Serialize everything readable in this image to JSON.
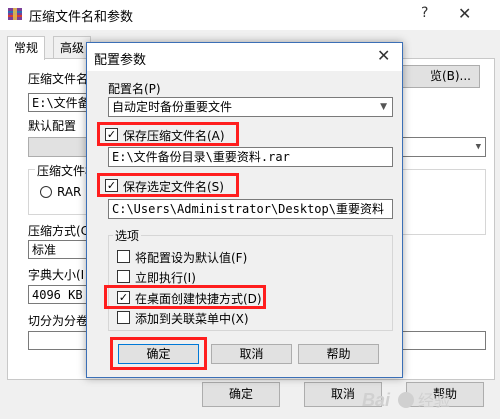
{
  "main": {
    "title": "压缩文件名和参数",
    "help": "?",
    "close": "✕",
    "tabs": [
      "常规",
      "高级"
    ],
    "archive_name_label": "压缩文件名",
    "archive_name_value": "E:\\文件备份",
    "browse_label": "览(B)...",
    "default_profile_label": "默认配置",
    "archive_format_label": "压缩文件格",
    "format_rar": "RAR",
    "method_label": "压缩方式(C",
    "method_value": "标准",
    "dict_label": "字典大小(I",
    "dict_value": "4096 KB",
    "split_label": "切分为分卷",
    "ok": "确定",
    "cancel": "取消",
    "help_btn": "帮助"
  },
  "dialog": {
    "title": "配置参数",
    "close": "✕",
    "profile_name_label": "配置名(P)",
    "profile_name_value": "自动定时备份重要文件",
    "save_archive_name_label": "保存压缩文件名(A)",
    "save_archive_name_checked": true,
    "archive_path": "E:\\文件备份目录\\重要资料.rar",
    "save_selected_names_label": "保存选定文件名(S)",
    "save_selected_names_checked": true,
    "selected_path": "C:\\Users\\Administrator\\Desktop\\重要资料",
    "options_group_label": "选项",
    "options": [
      {
        "label": "将配置设为默认值(F)",
        "checked": false
      },
      {
        "label": "立即执行(I)",
        "checked": false
      },
      {
        "label": "在桌面创建快捷方式(D)",
        "checked": true
      },
      {
        "label": "添加到关联菜单中(X)",
        "checked": false
      }
    ],
    "ok": "确定",
    "cancel": "取消",
    "help": "帮助"
  },
  "watermark": "Bai 经验",
  "colors": {
    "highlight": "#ff1e1e",
    "dialog_border": "#3b6fb6"
  }
}
